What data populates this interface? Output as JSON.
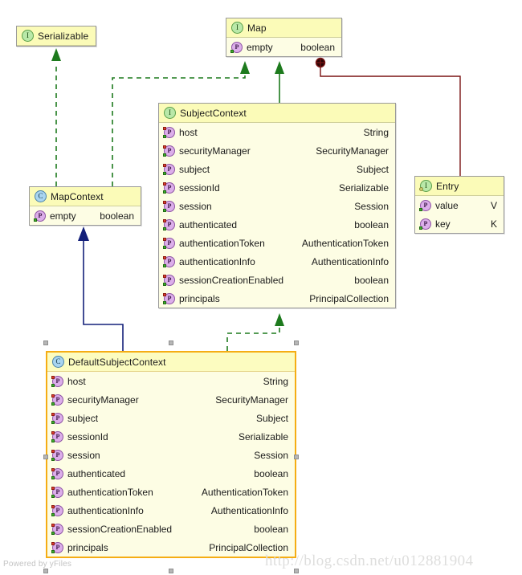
{
  "diagram": {
    "type": "uml-class-diagram",
    "watermarks": {
      "powered_by": "Powered by yFiles",
      "blog_url": "http://blog.csdn.net/u012881904"
    },
    "colors": {
      "box_fill": "#fdfde4",
      "header_fill": "#fbfbb8",
      "box_border": "#9a9a9a",
      "selected_border": "#f5ad14",
      "realization_edge": "#1d7a1d",
      "generalization_edge": "#1d7a1d",
      "inheritance_edge": "#14207a",
      "composition_edge": "#7a1414",
      "interface_icon": "#b9e8a8",
      "class_icon": "#a8d4f0",
      "property_icon": "#dcaeea"
    },
    "classes": [
      {
        "id": "serializable",
        "name": "Serializable",
        "stereotype": "interface",
        "icon": "interface-icon",
        "selected": false,
        "attributes": []
      },
      {
        "id": "map",
        "name": "Map",
        "stereotype": "interface",
        "icon": "interface-icon",
        "selected": false,
        "attributes": [
          {
            "icon": "property-icon",
            "name": "empty",
            "type": "boolean",
            "read": true,
            "write": false
          }
        ]
      },
      {
        "id": "subjectcontext",
        "name": "SubjectContext",
        "stereotype": "interface",
        "icon": "interface-icon",
        "selected": false,
        "attributes": [
          {
            "icon": "property-icon",
            "name": "host",
            "type": "String",
            "read": true,
            "write": true
          },
          {
            "icon": "property-icon",
            "name": "securityManager",
            "type": "SecurityManager",
            "read": true,
            "write": true
          },
          {
            "icon": "property-icon",
            "name": "subject",
            "type": "Subject",
            "read": true,
            "write": true
          },
          {
            "icon": "property-icon",
            "name": "sessionId",
            "type": "Serializable",
            "read": true,
            "write": true
          },
          {
            "icon": "property-icon",
            "name": "session",
            "type": "Session",
            "read": true,
            "write": true
          },
          {
            "icon": "property-icon",
            "name": "authenticated",
            "type": "boolean",
            "read": true,
            "write": true
          },
          {
            "icon": "property-icon",
            "name": "authenticationToken",
            "type": "AuthenticationToken",
            "read": true,
            "write": true
          },
          {
            "icon": "property-icon",
            "name": "authenticationInfo",
            "type": "AuthenticationInfo",
            "read": true,
            "write": true
          },
          {
            "icon": "property-icon",
            "name": "sessionCreationEnabled",
            "type": "boolean",
            "read": true,
            "write": true
          },
          {
            "icon": "property-icon",
            "name": "principals",
            "type": "PrincipalCollection",
            "read": true,
            "write": true
          }
        ]
      },
      {
        "id": "mapcontext",
        "name": "MapContext",
        "stereotype": "class",
        "icon": "class-icon",
        "selected": false,
        "attributes": [
          {
            "icon": "property-icon",
            "name": "empty",
            "type": "boolean",
            "read": true,
            "write": false
          }
        ]
      },
      {
        "id": "entry",
        "name": "Entry",
        "stereotype": "nested-interface",
        "icon": "nested-interface-icon",
        "selected": false,
        "attributes": [
          {
            "icon": "property-icon",
            "name": "value",
            "type": "V",
            "read": true,
            "write": false
          },
          {
            "icon": "property-icon",
            "name": "key",
            "type": "K",
            "read": true,
            "write": false
          }
        ]
      },
      {
        "id": "defaultsubjectcontext",
        "name": "DefaultSubjectContext",
        "stereotype": "class",
        "icon": "class-icon",
        "selected": true,
        "attributes": [
          {
            "icon": "property-icon",
            "name": "host",
            "type": "String",
            "read": true,
            "write": true
          },
          {
            "icon": "property-icon",
            "name": "securityManager",
            "type": "SecurityManager",
            "read": true,
            "write": true
          },
          {
            "icon": "property-icon",
            "name": "subject",
            "type": "Subject",
            "read": true,
            "write": true
          },
          {
            "icon": "property-icon",
            "name": "sessionId",
            "type": "Serializable",
            "read": true,
            "write": true
          },
          {
            "icon": "property-icon",
            "name": "session",
            "type": "Session",
            "read": true,
            "write": true
          },
          {
            "icon": "property-icon",
            "name": "authenticated",
            "type": "boolean",
            "read": true,
            "write": true
          },
          {
            "icon": "property-icon",
            "name": "authenticationToken",
            "type": "AuthenticationToken",
            "read": true,
            "write": true
          },
          {
            "icon": "property-icon",
            "name": "authenticationInfo",
            "type": "AuthenticationInfo",
            "read": true,
            "write": true
          },
          {
            "icon": "property-icon",
            "name": "sessionCreationEnabled",
            "type": "boolean",
            "read": true,
            "write": true
          },
          {
            "icon": "property-icon",
            "name": "principals",
            "type": "PrincipalCollection",
            "read": true,
            "write": true
          }
        ]
      }
    ],
    "relationships": [
      {
        "from": "mapcontext",
        "to": "serializable",
        "kind": "realization",
        "style": "dashed",
        "arrow": "filled-triangle",
        "color": "#1d7a1d"
      },
      {
        "from": "mapcontext",
        "to": "map",
        "kind": "realization",
        "style": "dashed",
        "arrow": "filled-triangle",
        "color": "#1d7a1d"
      },
      {
        "from": "subjectcontext",
        "to": "map",
        "kind": "generalization",
        "style": "solid",
        "arrow": "filled-triangle",
        "color": "#1d7a1d"
      },
      {
        "from": "defaultsubjectcontext",
        "to": "subjectcontext",
        "kind": "realization",
        "style": "dashed",
        "arrow": "filled-triangle",
        "color": "#1d7a1d"
      },
      {
        "from": "defaultsubjectcontext",
        "to": "mapcontext",
        "kind": "generalization",
        "style": "solid",
        "arrow": "filled-arrow",
        "color": "#14207a"
      },
      {
        "from": "map",
        "to": "entry",
        "kind": "composition",
        "style": "solid",
        "arrow": "filled-diamond",
        "color": "#7a1414"
      }
    ]
  }
}
